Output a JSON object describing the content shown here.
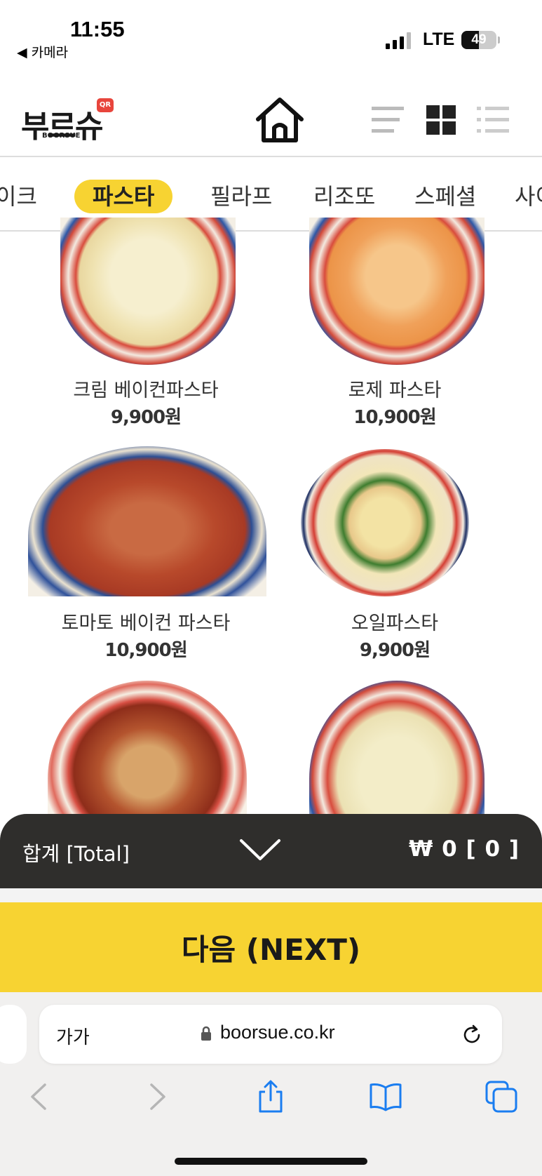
{
  "status": {
    "time": "11:55",
    "back_app": "◀ 카메라",
    "network": "LTE",
    "battery": "49",
    "battery_level": 0.49
  },
  "header": {
    "logo_text": "부르슈",
    "logo_sub": "BOORSUE",
    "logo_badge": "QR"
  },
  "tabs": [
    {
      "label": "이크",
      "active": false
    },
    {
      "label": "파스타",
      "active": true
    },
    {
      "label": "필라프",
      "active": false
    },
    {
      "label": "리조또",
      "active": false
    },
    {
      "label": "스페셜",
      "active": false
    },
    {
      "label": "사이",
      "active": false
    }
  ],
  "products": [
    {
      "name": "크림 베이컨파스타",
      "price": "9,900원"
    },
    {
      "name": "로제 파스타",
      "price": "10,900원"
    },
    {
      "name": "토마토 베이컨 파스타",
      "price": "10,900원"
    },
    {
      "name": "오일파스타",
      "price": "9,900원"
    },
    {
      "name": "",
      "price": ""
    },
    {
      "name": "",
      "price": ""
    }
  ],
  "total": {
    "label": "합계 [Total]",
    "amount": "₩ 0 [ 0 ]"
  },
  "next_button": "다음 (NEXT)",
  "browser": {
    "text_size": "가가",
    "url": "boorsue.co.kr"
  },
  "colors": {
    "accent": "#f7d332",
    "dark_bar": "#2f2e2c",
    "safari_blue": "#1a7df0"
  }
}
